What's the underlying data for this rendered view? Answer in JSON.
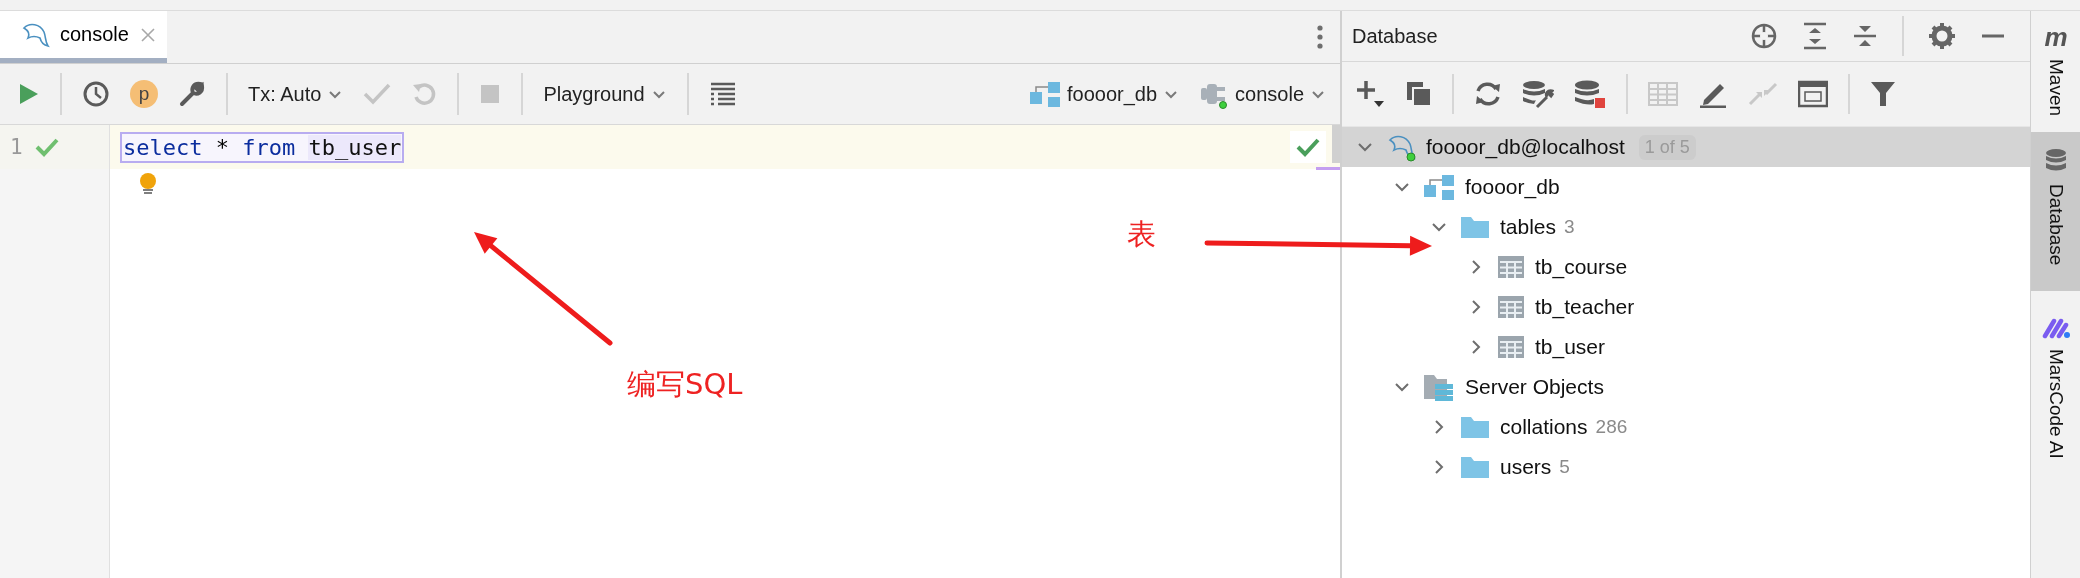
{
  "editor_tabs": [
    {
      "label": "console",
      "selected": true
    }
  ],
  "toolbar": {
    "profile": {
      "label": "p"
    },
    "tx_mode": {
      "label": "Tx: Auto"
    },
    "commit": {
      "disabled": true
    },
    "rollback": {
      "disabled": true
    },
    "stop": {
      "disabled": true
    },
    "mode": {
      "label": "Playground"
    },
    "schema": {
      "label": "foooor_db"
    },
    "session": {
      "label": "console"
    }
  },
  "editor": {
    "lines": [
      {
        "number": "1",
        "passed": true,
        "tokens": [
          {
            "kind": "keyword",
            "text": "select"
          },
          {
            "kind": "plain",
            "text": " * "
          },
          {
            "kind": "keyword",
            "text": "from"
          },
          {
            "kind": "highlight",
            "text": "tb_user",
            "gap_before": true
          }
        ]
      }
    ],
    "inspection_passed": true
  },
  "database": {
    "title": "Database",
    "tree": [
      {
        "kind": "datasource",
        "label": "foooor_db@localhost",
        "badge": "1 of 5",
        "expanded": true,
        "selected": true,
        "children": [
          {
            "kind": "schema",
            "label": "foooor_db",
            "expanded": true,
            "selected": false,
            "children": [
              {
                "kind": "folder",
                "label": "tables",
                "count": "3",
                "expanded": true,
                "selected": false,
                "children": [
                  {
                    "kind": "table",
                    "label": "tb_course",
                    "expanded": false,
                    "selected": false
                  },
                  {
                    "kind": "table",
                    "label": "tb_teacher",
                    "expanded": false,
                    "selected": false
                  },
                  {
                    "kind": "table",
                    "label": "tb_user",
                    "expanded": false,
                    "selected": false
                  }
                ]
              }
            ]
          },
          {
            "kind": "server",
            "label": "Server Objects",
            "expanded": true,
            "selected": false,
            "children": [
              {
                "kind": "folder",
                "label": "collations",
                "count": "286",
                "expanded": false,
                "selected": false
              },
              {
                "kind": "folder",
                "label": "users",
                "count": "5",
                "expanded": false,
                "selected": false
              }
            ]
          }
        ]
      }
    ]
  },
  "tool_strip": [
    {
      "kind": "maven",
      "icon_text": "m",
      "label": "Maven",
      "selected": false
    },
    {
      "kind": "database",
      "label": "Database",
      "selected": true
    },
    {
      "kind": "marscode",
      "label": "MarsCode AI",
      "selected": false
    }
  ],
  "annotations": [
    {
      "text": "编写SQL"
    },
    {
      "text": "表"
    }
  ]
}
